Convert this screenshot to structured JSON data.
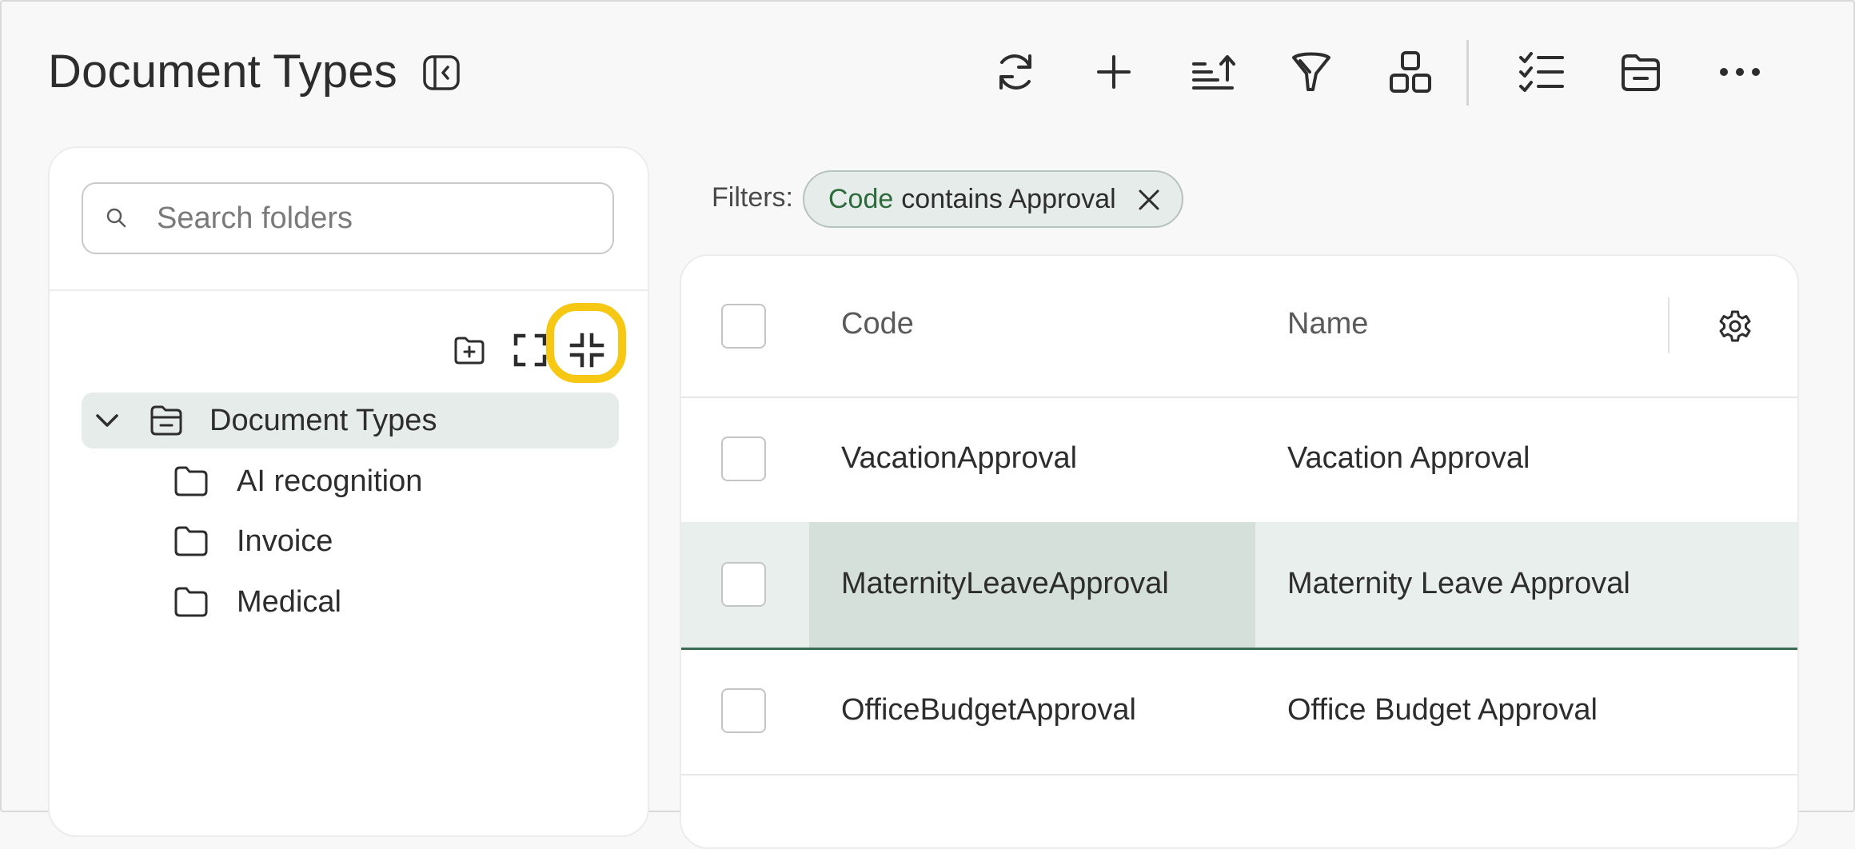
{
  "header": {
    "title": "Document Types",
    "toolbar_icons": [
      "refresh-icon",
      "plus-icon",
      "sort-icon",
      "filter-icon",
      "group-icon",
      "checklist-icon",
      "folder-minus-icon",
      "more-icon"
    ]
  },
  "sidebar": {
    "search_placeholder": "Search folders",
    "tree_action_icons": [
      "new-folder-icon",
      "expand-all-icon",
      "collapse-all-icon"
    ],
    "tree": {
      "root": "Document Types",
      "children": [
        "AI recognition",
        "Invoice",
        "Medical"
      ]
    }
  },
  "filters": {
    "label": "Filters:",
    "chip": {
      "field": "Code",
      "rest": "contains Approval"
    }
  },
  "table": {
    "columns": [
      "Code",
      "Name"
    ],
    "rows": [
      {
        "code": "VacationApproval",
        "name": "Vacation Approval",
        "selected": false
      },
      {
        "code": "MaternityLeaveApproval",
        "name": "Maternity Leave Approval",
        "selected": true
      },
      {
        "code": "OfficeBudgetApproval",
        "name": "Office Budget Approval",
        "selected": false
      }
    ]
  },
  "colors": {
    "highlight": "#f6c814",
    "accent_green": "#2d6a3c",
    "selected_row": "#e9efec"
  }
}
